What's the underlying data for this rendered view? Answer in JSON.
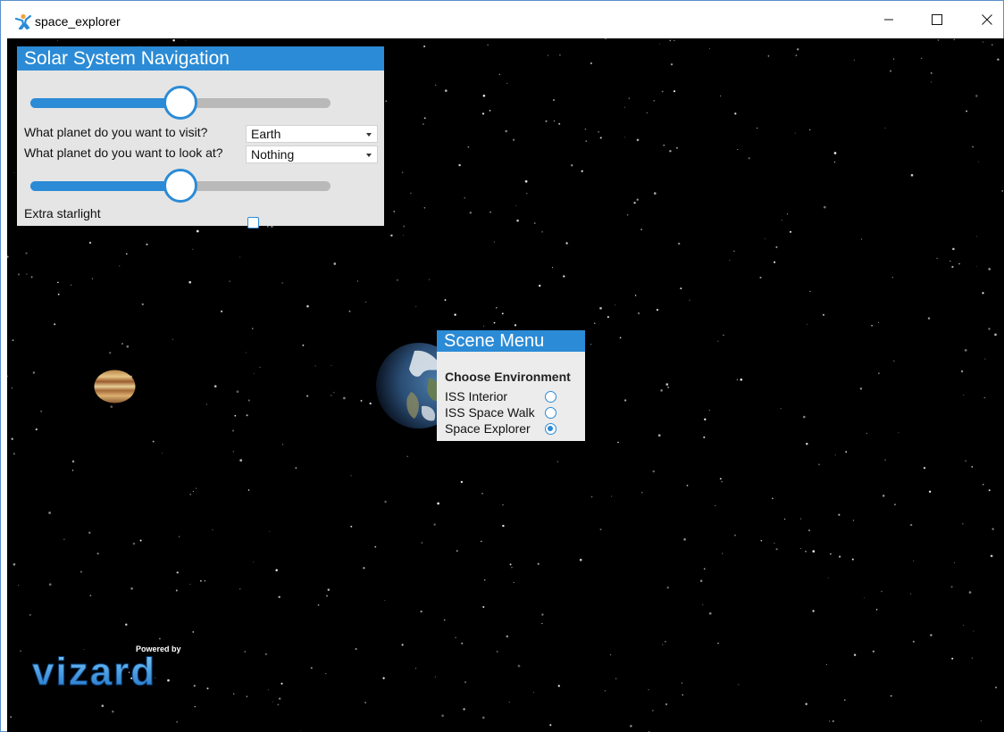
{
  "window": {
    "title": "space_explorer",
    "icon": "vizard-figure-icon",
    "controls": [
      "minimize-icon",
      "maximize-icon",
      "close-icon"
    ]
  },
  "solar_nav": {
    "title": "Solar System Navigation",
    "slider1_value_percent": 50,
    "visit_label": "What planet do you want to visit?",
    "visit_value": "Earth",
    "look_label": "What planet do you want to look at?",
    "look_value": "Nothing",
    "slider2_value_percent": 50,
    "starlight_label": "Extra starlight",
    "starlight_checked": false
  },
  "scene_menu": {
    "title": "Scene Menu",
    "subtitle": "Choose Environment",
    "options": [
      {
        "label": "ISS Interior",
        "checked": false
      },
      {
        "label": "ISS Space Walk",
        "checked": false
      },
      {
        "label": "Space Explorer",
        "checked": true
      }
    ]
  },
  "logo": {
    "powered_by": "Powered by",
    "name": "vizard"
  },
  "colors": {
    "accent": "#2b8bd6",
    "panel_bg": "#e5e5e5",
    "space": "#000000"
  }
}
